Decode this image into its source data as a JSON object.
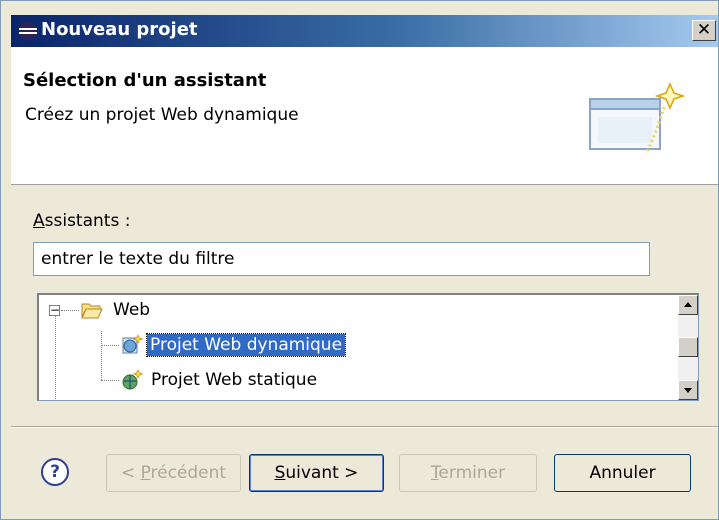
{
  "window": {
    "title": "Nouveau projet",
    "close_label": "✕"
  },
  "header": {
    "title": "Sélection d'un assistant",
    "description": "Créez un projet Web dynamique"
  },
  "filter": {
    "label_accel": "A",
    "label_rest": "ssistants :",
    "value": "entrer le texte du filtre"
  },
  "tree": {
    "expander": "−",
    "items": [
      {
        "label": "Web",
        "icon": "folder-open-icon"
      },
      {
        "label": "Projet Web dynamique",
        "icon": "dynamic-web-project-icon",
        "selected": true
      },
      {
        "label": "Projet Web statique",
        "icon": "static-web-project-icon"
      }
    ]
  },
  "buttons": {
    "help": "?",
    "back": {
      "prefix": "< ",
      "accel": "P",
      "rest": "récédent"
    },
    "next": {
      "accel": "S",
      "rest": "uivant >"
    },
    "finish": {
      "accel": "T",
      "rest": "erminer"
    },
    "cancel": "Annuler"
  }
}
